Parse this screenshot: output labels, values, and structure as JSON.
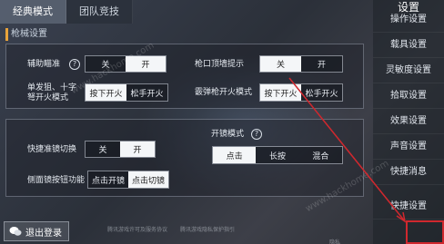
{
  "tabs": [
    "经典模式",
    "团队竞技"
  ],
  "section_title": "枪械设置",
  "rows": {
    "assist_aim": {
      "label": "辅助瞄准",
      "options": [
        "关",
        "开"
      ],
      "selected": 1
    },
    "muzzle_hint": {
      "label": "枪口顶墙提示",
      "options": [
        "关",
        "开"
      ],
      "selected": 0
    },
    "single_fire": {
      "label_line1": "单发狙、十字",
      "label_line2": "弩开火模式",
      "options": [
        "按下开火",
        "松手开火"
      ],
      "selected": 0
    },
    "shotgun_fire": {
      "label": "霰弹枪开火模式",
      "options": [
        "按下开火",
        "松手开火"
      ],
      "selected": 0
    },
    "quick_scope": {
      "label": "快捷准镜切换",
      "options": [
        "关",
        "开"
      ],
      "selected": 1
    },
    "scope_mode": {
      "label": "开镜模式",
      "help": "?",
      "options": [
        "点击",
        "长按",
        "混合"
      ],
      "selected": 0
    },
    "side_scope": {
      "label": "侧面镜按钮功能",
      "options": [
        "点击开镜",
        "点击切镜"
      ],
      "selected": 1
    },
    "assist_help": "?"
  },
  "sidebar": {
    "title": "设置",
    "items": [
      "操作设置",
      "载具设置",
      "灵敏度设置",
      "拾取设置",
      "效果设置",
      "声音设置",
      "快捷消息",
      "快捷设置"
    ]
  },
  "logout_label": "退出登录",
  "footer_notes": [
    "腾讯游戏许可及服务协议",
    "腾讯游戏隐私保护指引"
  ],
  "bottom_right_label": "隐私",
  "watermark": "www.hackhome.com",
  "colors": {
    "accent": "#e8a33a",
    "highlight": "#d0282e"
  }
}
